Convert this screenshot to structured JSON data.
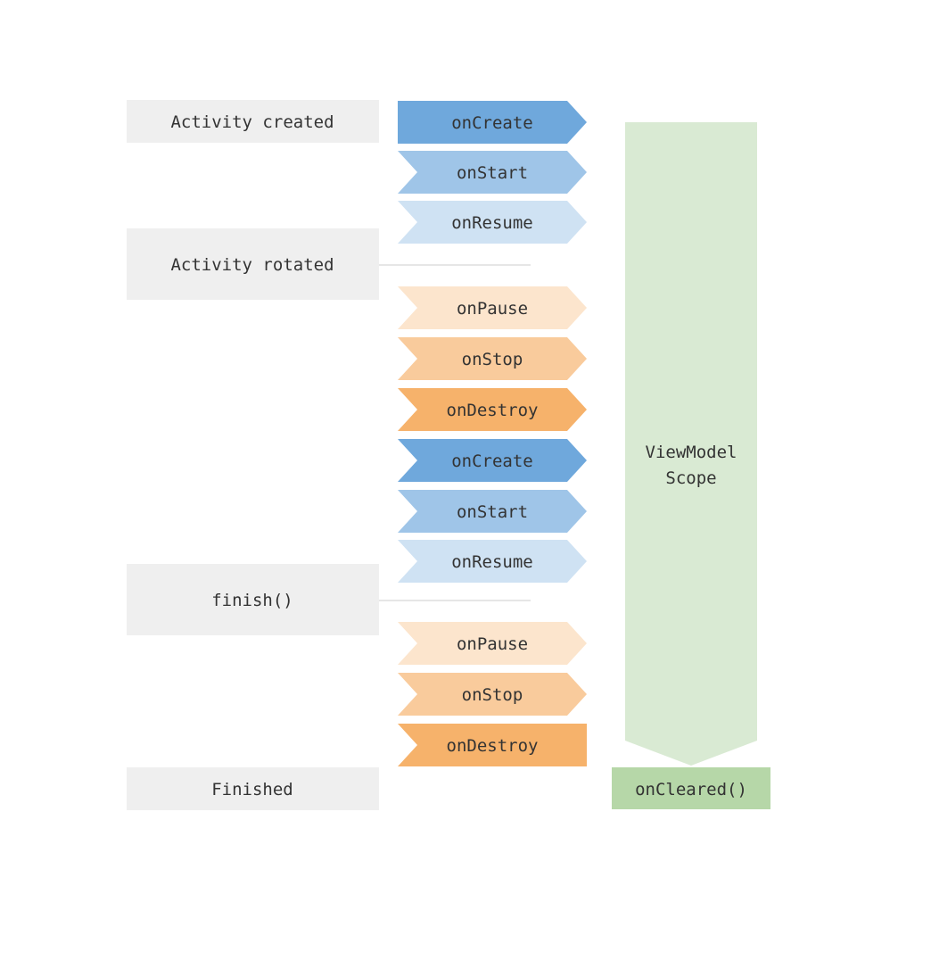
{
  "states": [
    {
      "label": "Activity created"
    },
    {
      "label": "Activity rotated"
    },
    {
      "label": "finish()"
    },
    {
      "label": "Finished"
    }
  ],
  "callbacks": [
    {
      "label": "onCreate",
      "color": "#6fa8dc"
    },
    {
      "label": "onStart",
      "color": "#9fc5e8"
    },
    {
      "label": "onResume",
      "color": "#cfe2f3"
    },
    {
      "label": "onPause",
      "color": "#fce5cd"
    },
    {
      "label": "onStop",
      "color": "#f9cb9c"
    },
    {
      "label": "onDestroy",
      "color": "#f6b26b"
    },
    {
      "label": "onCreate",
      "color": "#6fa8dc"
    },
    {
      "label": "onStart",
      "color": "#9fc5e8"
    },
    {
      "label": "onResume",
      "color": "#cfe2f3"
    },
    {
      "label": "onPause",
      "color": "#fce5cd"
    },
    {
      "label": "onStop",
      "color": "#f9cb9c"
    },
    {
      "label": "onDestroy",
      "color": "#f6b26b"
    }
  ],
  "viewmodel": {
    "line1": "ViewModel",
    "line2": "Scope",
    "color": "#d9ead3"
  },
  "cleared": {
    "label": "onCleared()",
    "color": "#b6d7a8"
  },
  "state_color": "#efefef"
}
